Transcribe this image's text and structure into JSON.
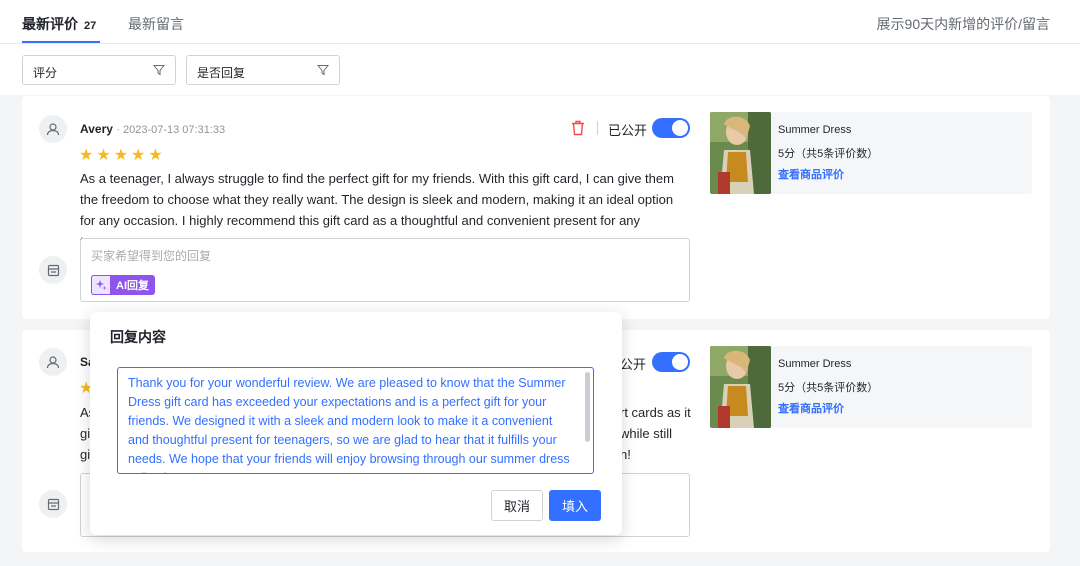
{
  "tabs": [
    {
      "label": "最新评价",
      "count": "27",
      "active": true
    },
    {
      "label": "最新留言",
      "active": false
    }
  ],
  "top_note": "展示90天内新增的评价/留言",
  "filters": {
    "score_placeholder": "评分",
    "reply_placeholder": "是否回复",
    "icon": "filter-icon"
  },
  "reviews": [
    {
      "name": "Avery",
      "date": "· 2023-07-13 07:31:33",
      "stars": "★★★★★",
      "text": "As a teenager, I always struggle to find the perfect gift for my friends. With this gift card, I can give them the freedom to choose what they really want. The design is sleek and modern, making it an ideal option for any occasion. I highly recommend this gift card as a thoughtful and convenient present for any teenager.",
      "reply_placeholder": "买家希望得到您的回复",
      "ai_reply_label": "AI回复",
      "public_label": "已公开",
      "public_on": true,
      "product": {
        "name": "Summer Dress",
        "score": "5分（共5条评价数）",
        "link": "查看商品评价"
      }
    },
    {
      "name": "Sa",
      "stars": "★",
      "text_fragments": [
        "As",
        "gi",
        "gi"
      ],
      "text_right_fragments": [
        "rt cards as it",
        "while still",
        "n!"
      ],
      "public_label": "公开",
      "public_on": true,
      "product": {
        "name": "Summer Dress",
        "score": "5分（共5条评价数）",
        "link": "查看商品评价"
      }
    }
  ],
  "popup": {
    "title": "回复内容",
    "content": "Thank you for your wonderful review. We are pleased to know that the Summer Dress gift card has exceeded your expectations and is a perfect gift for your friends. We designed it with a sleek and modern look to make it a convenient and thoughtful present for teenagers, so we are glad to hear that it fulfills your needs. We hope that your friends will enjoy browsing through our summer dress collection.",
    "cancel_label": "取消",
    "fill_label": "填入"
  },
  "colors": {
    "accent": "#3370ff",
    "star": "#f7ba1e",
    "ai_purple": "#8d55ed",
    "delete_red": "#f54a45"
  }
}
